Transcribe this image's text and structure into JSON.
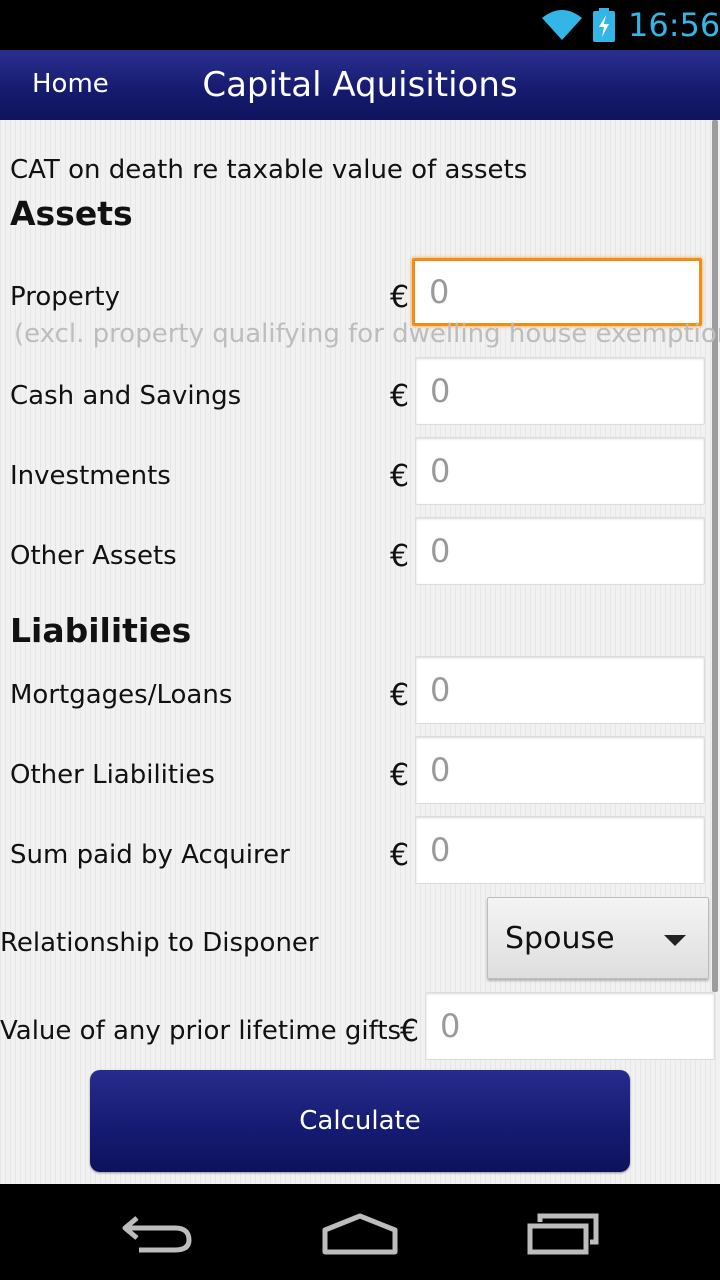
{
  "status_bar": {
    "time": "16:56",
    "wifi_icon": "wifi-icon",
    "battery_icon": "battery-charging-icon",
    "accent": "#33b5e5"
  },
  "action_bar": {
    "home_label": "Home",
    "title": "Capital Aquisitions",
    "color": "#151a6e"
  },
  "form": {
    "subtitle": "CAT on death re taxable value of assets",
    "assets_heading": "Assets",
    "liabilities_heading": "Liabilities",
    "currency_symbol": "€",
    "property_hint": "(excl. property qualifying for dwelling house exemption)",
    "fields": {
      "property": {
        "label": "Property",
        "value": "0"
      },
      "cash_savings": {
        "label": "Cash and Savings",
        "value": "0"
      },
      "investments": {
        "label": "Investments",
        "value": "0"
      },
      "other_assets": {
        "label": "Other Assets",
        "value": "0"
      },
      "mortgages_loans": {
        "label": "Mortgages/Loans",
        "value": "0"
      },
      "other_liabilities": {
        "label": "Other Liabilities",
        "value": "0"
      },
      "sum_paid": {
        "label": "Sum paid by Acquirer",
        "value": "0"
      },
      "prior_gifts": {
        "label": "Value of any prior lifetime gifts",
        "value": "0"
      }
    },
    "relationship": {
      "label": "Relationship to Disponer",
      "selected": "Spouse"
    },
    "focus_color": "#f28d14"
  },
  "calculate_label": "Calculate",
  "nav_bar": {
    "back_icon": "back-icon",
    "home_icon": "home-icon",
    "recents_icon": "recent-apps-icon"
  }
}
